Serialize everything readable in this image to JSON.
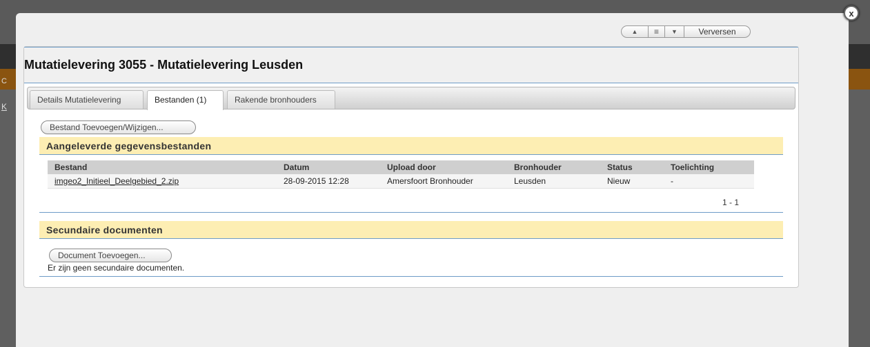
{
  "background": {
    "letter_a": "C",
    "letter_b": "K"
  },
  "modal": {
    "close_label": "x",
    "toolbar": {
      "up_icon": "▲",
      "list_icon": "≡",
      "down_icon": "▼",
      "refresh_label": "Verversen"
    },
    "title": "Mutatielevering 3055 - Mutatielevering Leusden",
    "tabs": [
      {
        "label": "Details Mutatielevering",
        "active": false
      },
      {
        "label": "Bestanden (1)",
        "active": true
      },
      {
        "label": "Rakende bronhouders",
        "active": false
      }
    ],
    "files_section": {
      "button_label": "Bestand Toevoegen/Wijzigen...",
      "title": "Aangeleverde gegevensbestanden",
      "columns": [
        "Bestand",
        "Datum",
        "Upload door",
        "Bronhouder",
        "Status",
        "Toelichting"
      ],
      "rows": [
        {
          "bestand": "imgeo2_Initieel_Deelgebied_2.zip",
          "datum": "28-09-2015 12:28",
          "upload_door": "Amersfoort Bronhouder",
          "bronhouder": "Leusden",
          "status": "Nieuw",
          "toelichting": "-"
        }
      ],
      "pager": "1 - 1"
    },
    "secondary_section": {
      "title": "Secundaire documenten",
      "button_label": "Document Toevoegen...",
      "empty_message": "Er zijn geen secundaire documenten."
    }
  }
}
